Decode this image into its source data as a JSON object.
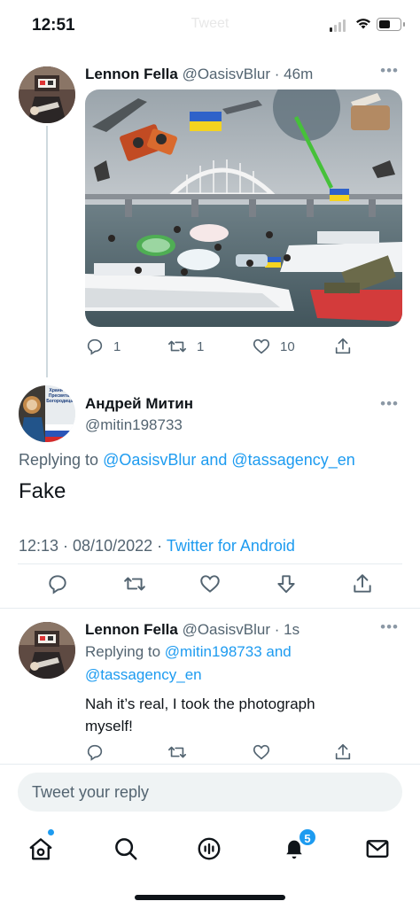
{
  "status_bar": {
    "time": "12:51",
    "faded_header": "Tweet"
  },
  "tweets": [
    {
      "display_name": "Lennon Fella",
      "handle": "@OasisvBlur",
      "age": "46m",
      "stats": {
        "replies": "1",
        "retweets": "1",
        "likes": "10"
      }
    },
    {
      "display_name": "Андрей Митин",
      "handle": "@mitin198733",
      "avatar_text": "Храни бог Пресвятая Богородица!",
      "replying_prefix": "Replying to",
      "replying_mentions": "@OasisvBlur and @tassagency_en",
      "text": "Fake",
      "timestamp": "12:13 · 08/10/2022 ·",
      "source": "Twitter for Android"
    },
    {
      "display_name": "Lennon Fella",
      "handle": "@OasisvBlur",
      "age": "1s",
      "replying_prefix": "Replying to",
      "replying_mention_1": "@mitin198733 and",
      "replying_mention_2": "@tassagency_en",
      "text_line_1": "Nah it’s real, I took the photograph",
      "text_line_2": "myself!"
    }
  ],
  "reply_box": {
    "placeholder": "Tweet your reply"
  },
  "tab_bar": {
    "notifications_badge": "5"
  },
  "colors": {
    "accent": "#1d9bf0",
    "text": "#0f1419",
    "muted": "#536471"
  }
}
